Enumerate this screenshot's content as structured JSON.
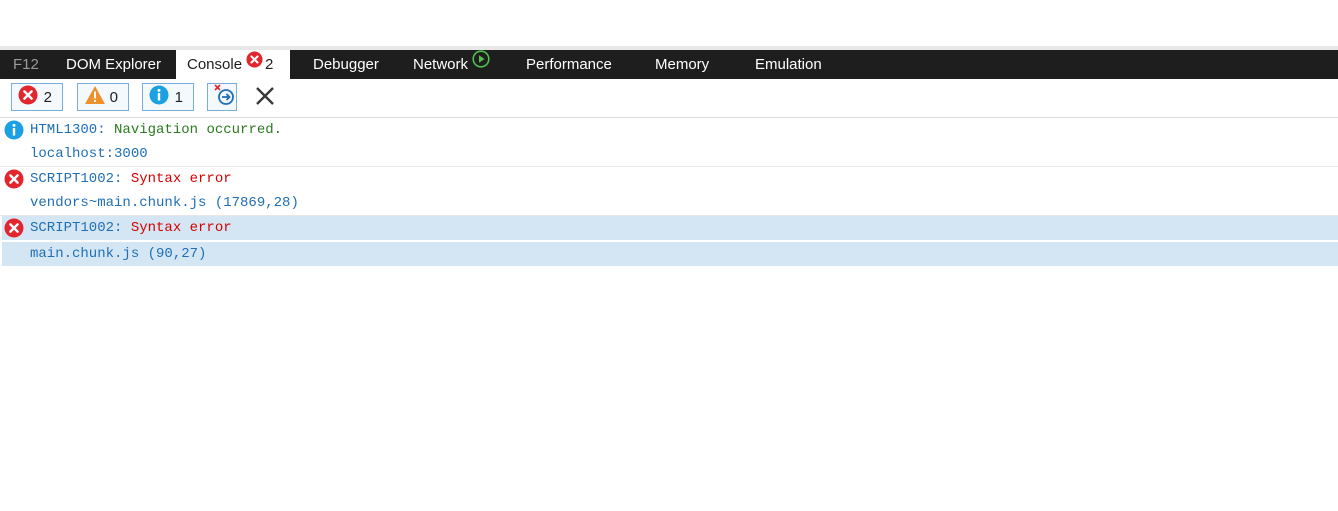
{
  "tabs": {
    "f12": "F12",
    "dom_explorer": "DOM Explorer",
    "console": "Console",
    "console_error_count": "2",
    "debugger": "Debugger",
    "network": "Network",
    "performance": "Performance",
    "memory": "Memory",
    "emulation": "Emulation"
  },
  "toolbar": {
    "errors_count": "2",
    "warnings_count": "0",
    "info_count": "1"
  },
  "log": [
    {
      "type": "info",
      "icon": "info-icon",
      "code": "HTML1300",
      "separator": ":",
      "message": " Navigation occurred.",
      "source": "localhost:3000"
    },
    {
      "type": "error",
      "icon": "error-icon",
      "code": "SCRIPT1002",
      "separator": ":",
      "message": " Syntax error",
      "source": "vendors~main.chunk.js (17869,28)"
    },
    {
      "type": "error",
      "icon": "error-icon",
      "code": "SCRIPT1002",
      "separator": ":",
      "message": " Syntax error",
      "source": "main.chunk.js (90,27)"
    }
  ],
  "colors": {
    "error": "#e3262e",
    "warning": "#f0902a",
    "info": "#1ba1e2",
    "selected_row": "#d4e6f4",
    "tabbar": "#1e1e1e"
  }
}
